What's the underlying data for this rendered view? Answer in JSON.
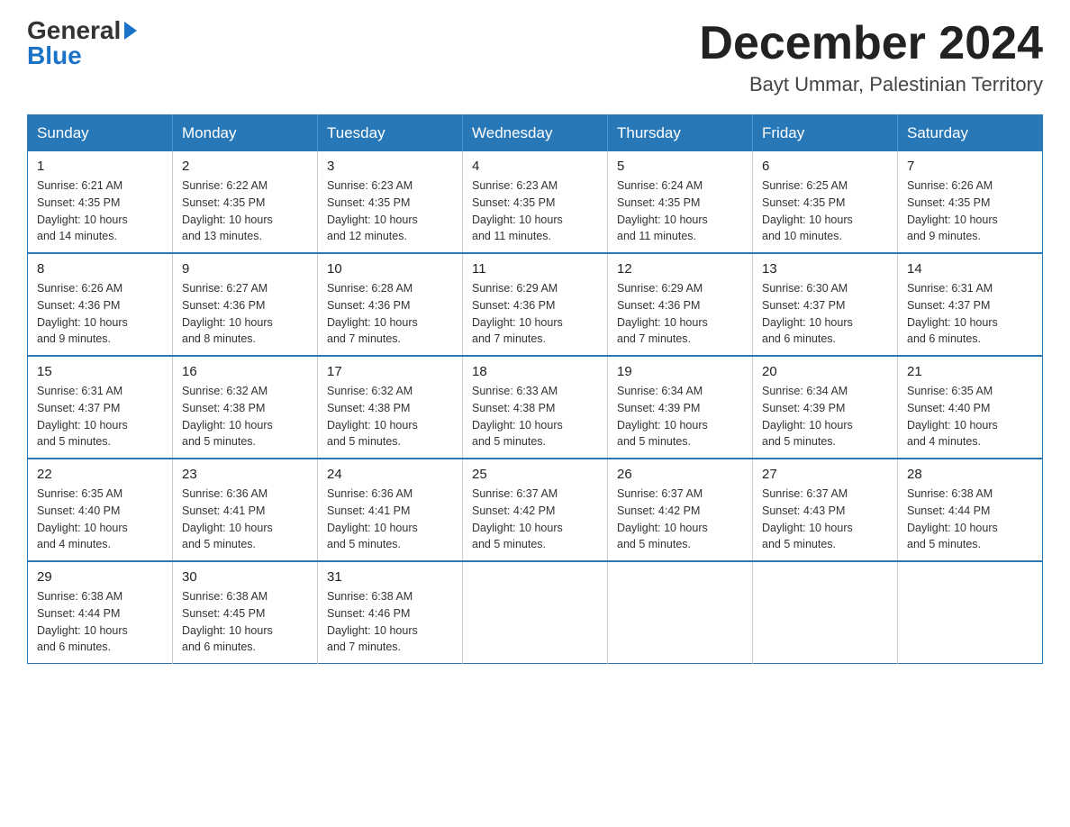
{
  "logo": {
    "general": "General",
    "blue": "Blue"
  },
  "header": {
    "month": "December 2024",
    "location": "Bayt Ummar, Palestinian Territory"
  },
  "weekdays": [
    "Sunday",
    "Monday",
    "Tuesday",
    "Wednesday",
    "Thursday",
    "Friday",
    "Saturday"
  ],
  "weeks": [
    [
      {
        "day": "1",
        "sunrise": "6:21 AM",
        "sunset": "4:35 PM",
        "daylight": "10 hours and 14 minutes."
      },
      {
        "day": "2",
        "sunrise": "6:22 AM",
        "sunset": "4:35 PM",
        "daylight": "10 hours and 13 minutes."
      },
      {
        "day": "3",
        "sunrise": "6:23 AM",
        "sunset": "4:35 PM",
        "daylight": "10 hours and 12 minutes."
      },
      {
        "day": "4",
        "sunrise": "6:23 AM",
        "sunset": "4:35 PM",
        "daylight": "10 hours and 11 minutes."
      },
      {
        "day": "5",
        "sunrise": "6:24 AM",
        "sunset": "4:35 PM",
        "daylight": "10 hours and 11 minutes."
      },
      {
        "day": "6",
        "sunrise": "6:25 AM",
        "sunset": "4:35 PM",
        "daylight": "10 hours and 10 minutes."
      },
      {
        "day": "7",
        "sunrise": "6:26 AM",
        "sunset": "4:35 PM",
        "daylight": "10 hours and 9 minutes."
      }
    ],
    [
      {
        "day": "8",
        "sunrise": "6:26 AM",
        "sunset": "4:36 PM",
        "daylight": "10 hours and 9 minutes."
      },
      {
        "day": "9",
        "sunrise": "6:27 AM",
        "sunset": "4:36 PM",
        "daylight": "10 hours and 8 minutes."
      },
      {
        "day": "10",
        "sunrise": "6:28 AM",
        "sunset": "4:36 PM",
        "daylight": "10 hours and 7 minutes."
      },
      {
        "day": "11",
        "sunrise": "6:29 AM",
        "sunset": "4:36 PM",
        "daylight": "10 hours and 7 minutes."
      },
      {
        "day": "12",
        "sunrise": "6:29 AM",
        "sunset": "4:36 PM",
        "daylight": "10 hours and 7 minutes."
      },
      {
        "day": "13",
        "sunrise": "6:30 AM",
        "sunset": "4:37 PM",
        "daylight": "10 hours and 6 minutes."
      },
      {
        "day": "14",
        "sunrise": "6:31 AM",
        "sunset": "4:37 PM",
        "daylight": "10 hours and 6 minutes."
      }
    ],
    [
      {
        "day": "15",
        "sunrise": "6:31 AM",
        "sunset": "4:37 PM",
        "daylight": "10 hours and 5 minutes."
      },
      {
        "day": "16",
        "sunrise": "6:32 AM",
        "sunset": "4:38 PM",
        "daylight": "10 hours and 5 minutes."
      },
      {
        "day": "17",
        "sunrise": "6:32 AM",
        "sunset": "4:38 PM",
        "daylight": "10 hours and 5 minutes."
      },
      {
        "day": "18",
        "sunrise": "6:33 AM",
        "sunset": "4:38 PM",
        "daylight": "10 hours and 5 minutes."
      },
      {
        "day": "19",
        "sunrise": "6:34 AM",
        "sunset": "4:39 PM",
        "daylight": "10 hours and 5 minutes."
      },
      {
        "day": "20",
        "sunrise": "6:34 AM",
        "sunset": "4:39 PM",
        "daylight": "10 hours and 5 minutes."
      },
      {
        "day": "21",
        "sunrise": "6:35 AM",
        "sunset": "4:40 PM",
        "daylight": "10 hours and 4 minutes."
      }
    ],
    [
      {
        "day": "22",
        "sunrise": "6:35 AM",
        "sunset": "4:40 PM",
        "daylight": "10 hours and 4 minutes."
      },
      {
        "day": "23",
        "sunrise": "6:36 AM",
        "sunset": "4:41 PM",
        "daylight": "10 hours and 5 minutes."
      },
      {
        "day": "24",
        "sunrise": "6:36 AM",
        "sunset": "4:41 PM",
        "daylight": "10 hours and 5 minutes."
      },
      {
        "day": "25",
        "sunrise": "6:37 AM",
        "sunset": "4:42 PM",
        "daylight": "10 hours and 5 minutes."
      },
      {
        "day": "26",
        "sunrise": "6:37 AM",
        "sunset": "4:42 PM",
        "daylight": "10 hours and 5 minutes."
      },
      {
        "day": "27",
        "sunrise": "6:37 AM",
        "sunset": "4:43 PM",
        "daylight": "10 hours and 5 minutes."
      },
      {
        "day": "28",
        "sunrise": "6:38 AM",
        "sunset": "4:44 PM",
        "daylight": "10 hours and 5 minutes."
      }
    ],
    [
      {
        "day": "29",
        "sunrise": "6:38 AM",
        "sunset": "4:44 PM",
        "daylight": "10 hours and 6 minutes."
      },
      {
        "day": "30",
        "sunrise": "6:38 AM",
        "sunset": "4:45 PM",
        "daylight": "10 hours and 6 minutes."
      },
      {
        "day": "31",
        "sunrise": "6:38 AM",
        "sunset": "4:46 PM",
        "daylight": "10 hours and 7 minutes."
      },
      null,
      null,
      null,
      null
    ]
  ],
  "labels": {
    "sunrise": "Sunrise:",
    "sunset": "Sunset:",
    "daylight": "Daylight:"
  }
}
